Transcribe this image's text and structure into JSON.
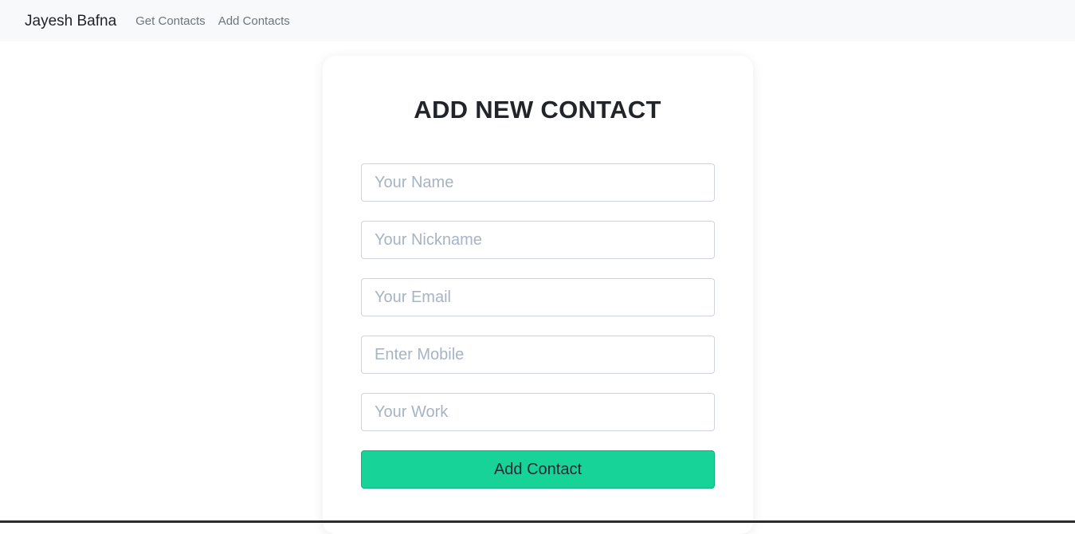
{
  "navbar": {
    "brand": "Jayesh Bafna",
    "links": [
      "Get Contacts",
      "Add Contacts"
    ]
  },
  "form": {
    "title": "ADD NEW CONTACT",
    "fields": [
      {
        "placeholder": "Your Name",
        "value": ""
      },
      {
        "placeholder": "Your Nickname",
        "value": ""
      },
      {
        "placeholder": "Your Email",
        "value": ""
      },
      {
        "placeholder": "Enter Mobile",
        "value": ""
      },
      {
        "placeholder": "Your Work",
        "value": ""
      }
    ],
    "submit_label": "Add Contact"
  },
  "colors": {
    "navbar_bg": "#f8f9fa",
    "button_bg": "#17d398",
    "placeholder": "#a8b3c5"
  }
}
